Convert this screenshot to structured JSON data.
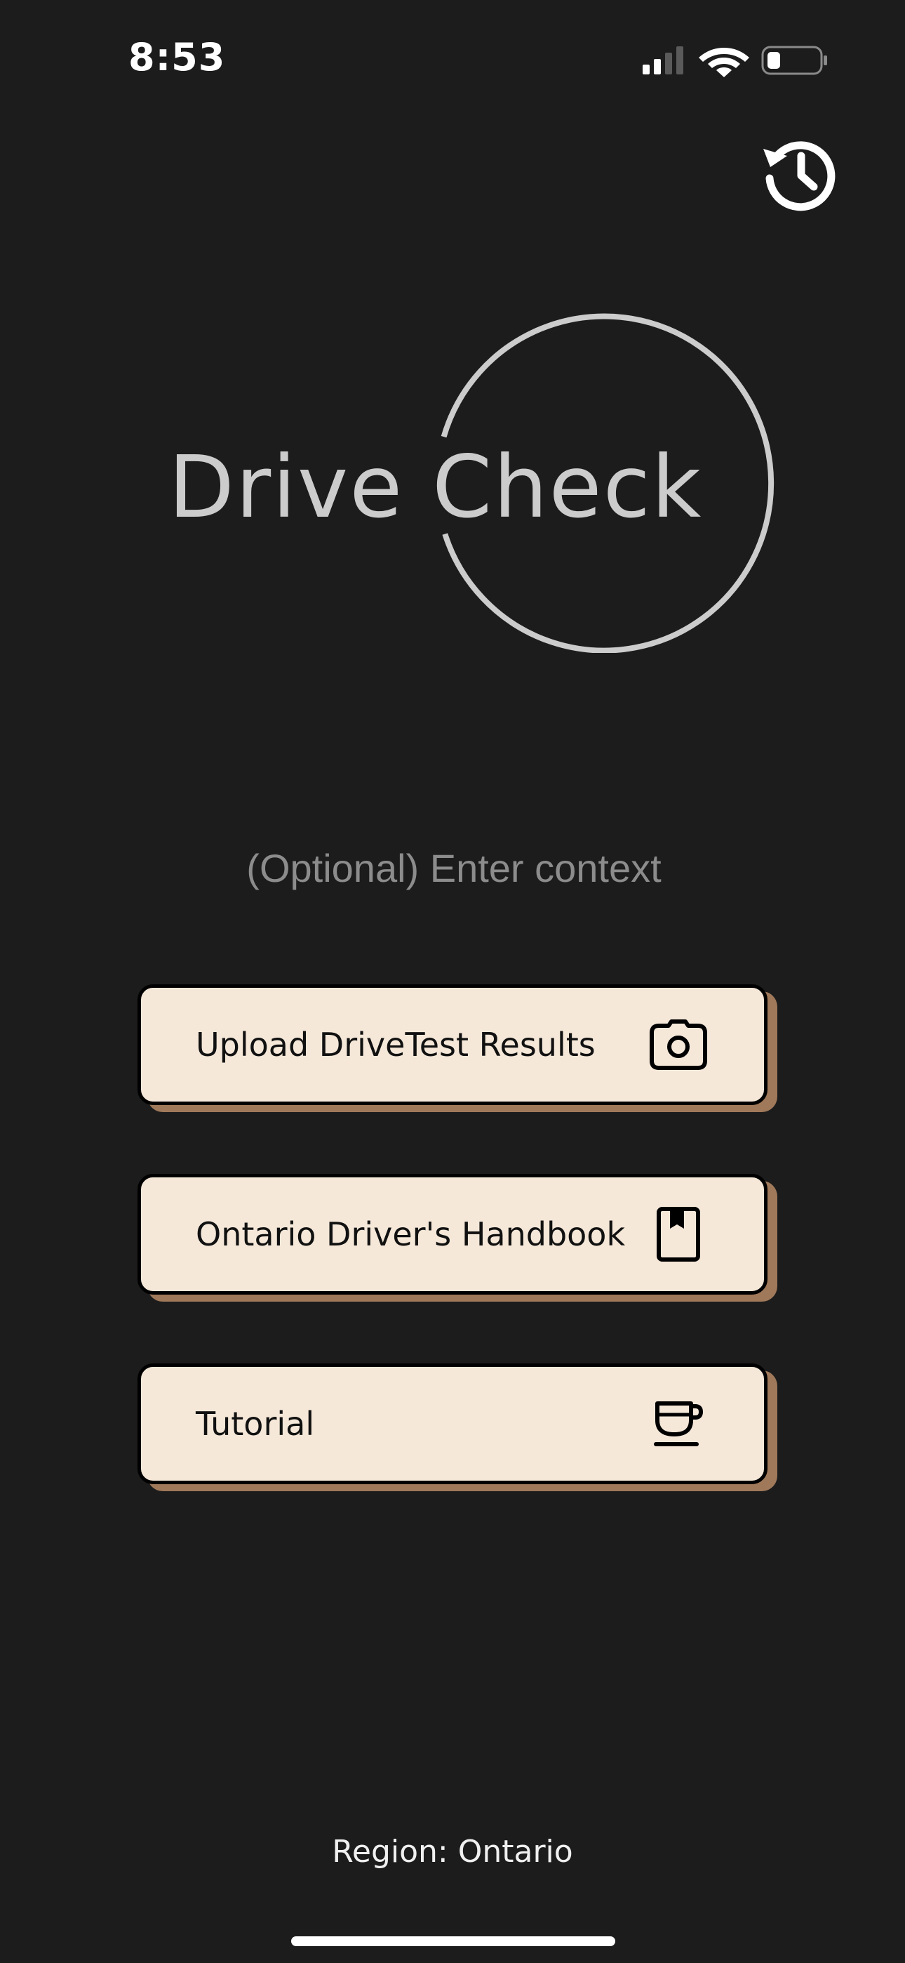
{
  "status_bar": {
    "time": "8:53"
  },
  "header": {
    "history_icon": "history-icon"
  },
  "logo": {
    "text": "Drive Check"
  },
  "context": {
    "placeholder": "(Optional) Enter context",
    "value": ""
  },
  "menu": {
    "upload": {
      "label": "Upload DriveTest Results",
      "icon": "camera-icon"
    },
    "handbook": {
      "label": "Ontario Driver's Handbook",
      "icon": "book-icon"
    },
    "tutorial": {
      "label": "Tutorial",
      "icon": "coffee-cup-icon"
    }
  },
  "footer": {
    "region": "Region: Ontario"
  },
  "colors": {
    "background": "#1c1c1c",
    "button_fill": "#f5e8d9",
    "button_shadow": "#a0795a",
    "logo": "#cccccc"
  }
}
